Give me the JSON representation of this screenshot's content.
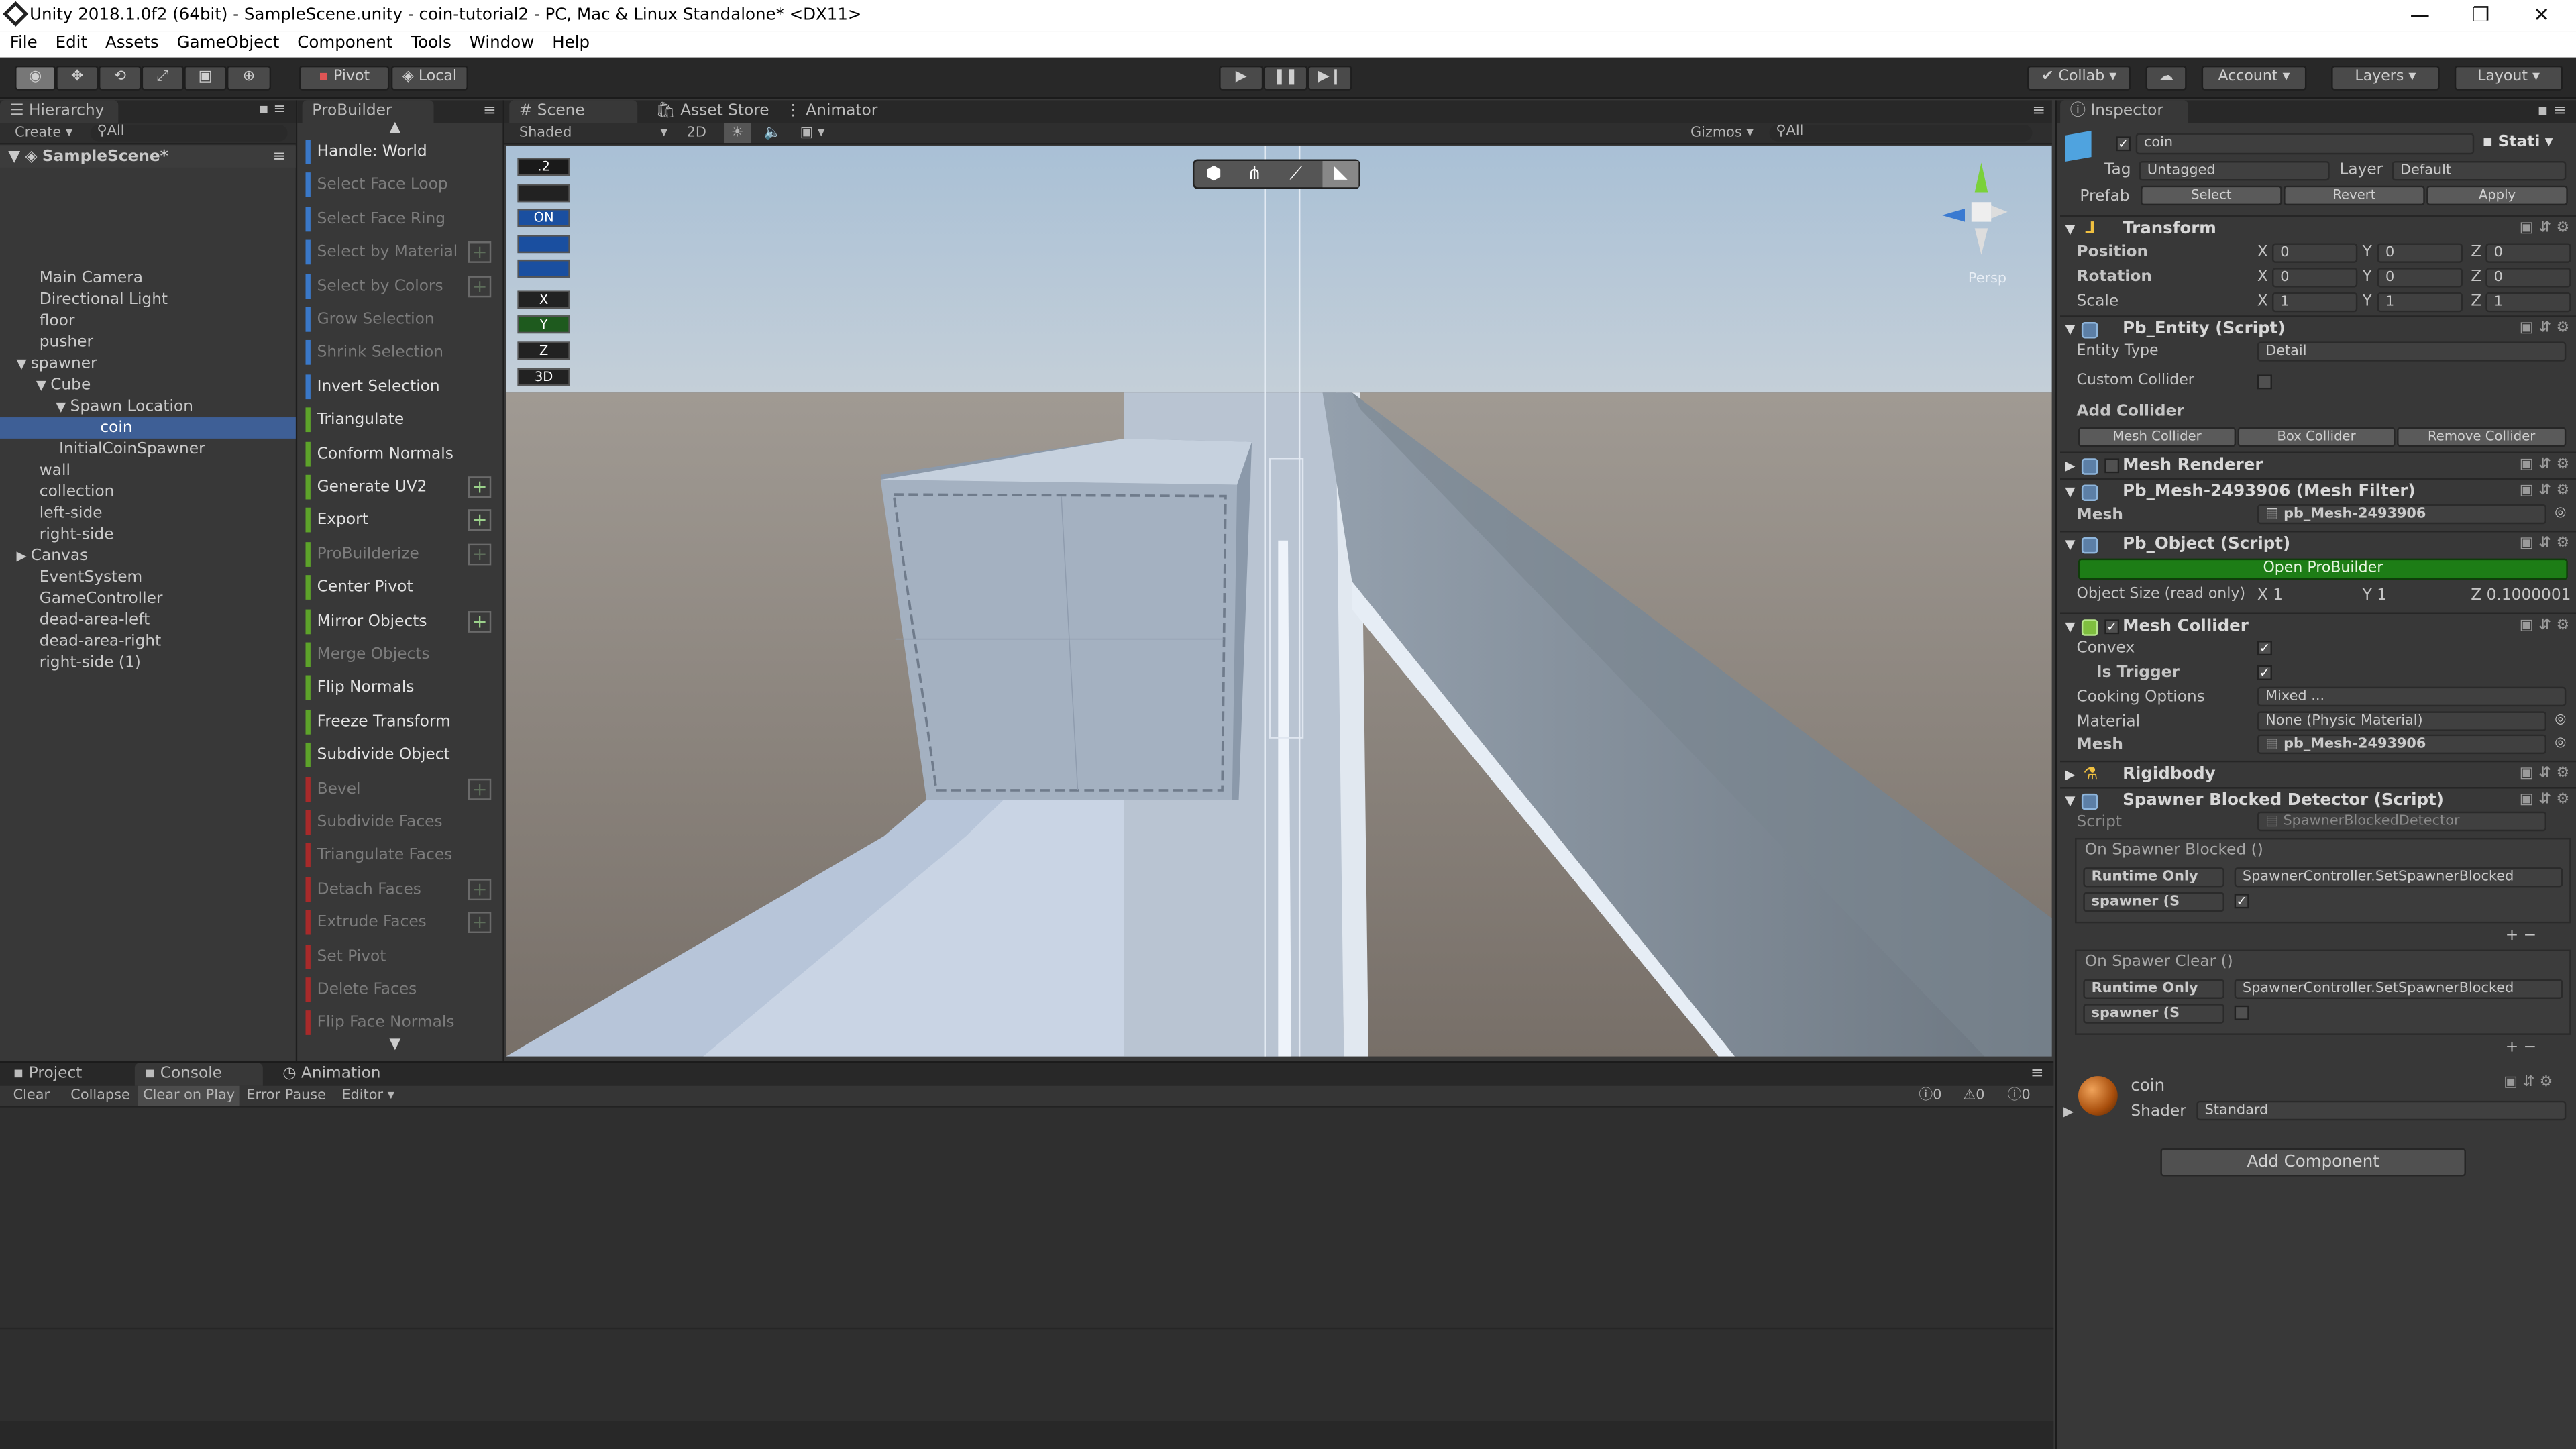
{
  "window": {
    "title": "Unity 2018.1.0f2 (64bit) - SampleScene.unity - coin-tutorial2 - PC, Mac & Linux Standalone* <DX11>",
    "controls": [
      "—",
      "❐",
      "✕"
    ]
  },
  "menu": [
    "File",
    "Edit",
    "Assets",
    "GameObject",
    "Component",
    "Tools",
    "Window",
    "Help"
  ],
  "toolbar": {
    "pivot": "Pivot",
    "local": "Local",
    "collab": "Collab",
    "account": "Account",
    "layers": "Layers",
    "layout": "Layout"
  },
  "hierarchy": {
    "tab": "Hierarchy",
    "create": "Create",
    "search": "All",
    "scene": "SampleScene*",
    "items": [
      {
        "label": "Main Camera",
        "indent": 1
      },
      {
        "label": "Directional Light",
        "indent": 1
      },
      {
        "label": "floor",
        "indent": 1
      },
      {
        "label": "pusher",
        "indent": 1
      },
      {
        "label": "spawner",
        "indent": 1,
        "arrow": "▼"
      },
      {
        "label": "Cube",
        "indent": 2,
        "arrow": "▼"
      },
      {
        "label": "Spawn Location",
        "indent": 3,
        "arrow": "▼"
      },
      {
        "label": "coin",
        "indent": 4,
        "selected": true
      },
      {
        "label": "InitialCoinSpawner",
        "indent": 2
      },
      {
        "label": "wall",
        "indent": 1
      },
      {
        "label": "collection",
        "indent": 1
      },
      {
        "label": "left-side",
        "indent": 1
      },
      {
        "label": "right-side",
        "indent": 1
      },
      {
        "label": "Canvas",
        "indent": 1,
        "arrow": "▶"
      },
      {
        "label": "EventSystem",
        "indent": 1
      },
      {
        "label": "GameController",
        "indent": 1
      },
      {
        "label": "dead-area-left",
        "indent": 1
      },
      {
        "label": "dead-area-right",
        "indent": 1
      },
      {
        "label": "right-side (1)",
        "indent": 1
      }
    ]
  },
  "probuilder": {
    "tab": "ProBuilder",
    "items": [
      {
        "label": "Handle: World",
        "color": "#3a78c8",
        "enabled": true
      },
      {
        "label": "Select Face Loop",
        "color": "#3a78c8",
        "enabled": false
      },
      {
        "label": "Select Face Ring",
        "color": "#3a78c8",
        "enabled": false
      },
      {
        "label": "Select by Material",
        "color": "#3a78c8",
        "enabled": false,
        "plus": true
      },
      {
        "label": "Select by Colors",
        "color": "#3a78c8",
        "enabled": false,
        "plus": true
      },
      {
        "label": "Grow Selection",
        "color": "#3a78c8",
        "enabled": false
      },
      {
        "label": "Shrink Selection",
        "color": "#3a78c8",
        "enabled": false
      },
      {
        "label": "Invert Selection",
        "color": "#3a78c8",
        "enabled": true
      },
      {
        "label": "Triangulate",
        "color": "#5da32a",
        "enabled": true
      },
      {
        "label": "Conform Normals",
        "color": "#5da32a",
        "enabled": true
      },
      {
        "label": "Generate UV2",
        "color": "#5da32a",
        "enabled": true,
        "plus": true
      },
      {
        "label": "Export",
        "color": "#5da32a",
        "enabled": true,
        "plus": true
      },
      {
        "label": "ProBuilderize",
        "color": "#5da32a",
        "enabled": false,
        "plus": true
      },
      {
        "label": "Center Pivot",
        "color": "#5da32a",
        "enabled": true
      },
      {
        "label": "Mirror Objects",
        "color": "#5da32a",
        "enabled": true,
        "plus": true
      },
      {
        "label": "Merge Objects",
        "color": "#5da32a",
        "enabled": false
      },
      {
        "label": "Flip Normals",
        "color": "#5da32a",
        "enabled": true
      },
      {
        "label": "Freeze Transform",
        "color": "#5da32a",
        "enabled": true
      },
      {
        "label": "Subdivide Object",
        "color": "#5da32a",
        "enabled": true
      },
      {
        "label": "Bevel",
        "color": "#a82a2a",
        "enabled": false,
        "plus": true
      },
      {
        "label": "Subdivide Faces",
        "color": "#a82a2a",
        "enabled": false
      },
      {
        "label": "Triangulate Faces",
        "color": "#a82a2a",
        "enabled": false
      },
      {
        "label": "Detach Faces",
        "color": "#a82a2a",
        "enabled": false,
        "plus": true
      },
      {
        "label": "Extrude Faces",
        "color": "#a82a2a",
        "enabled": false,
        "plus": true
      },
      {
        "label": "Set Pivot",
        "color": "#a82a2a",
        "enabled": false
      },
      {
        "label": "Delete Faces",
        "color": "#a82a2a",
        "enabled": false
      },
      {
        "label": "Flip Face Normals",
        "color": "#a82a2a",
        "enabled": false
      }
    ]
  },
  "scene": {
    "tabs": [
      "Scene",
      "Asset Store",
      "Animator"
    ],
    "shading": "Shaded",
    "mode2d": "2D",
    "gizmos": "Gizmos",
    "search": "All",
    "persp": "Persp",
    "tools": [
      ".2",
      "",
      "ON",
      "",
      "",
      "X",
      "Y",
      "Z",
      "3D"
    ]
  },
  "console": {
    "tabs": [
      "Project",
      "Console",
      "Animation"
    ],
    "buttons": [
      "Clear",
      "Collapse",
      "Clear on Play",
      "Error Pause",
      "Editor"
    ],
    "counts": [
      "0",
      "0",
      "0"
    ]
  },
  "inspector": {
    "tab": "Inspector",
    "object_name": "coin",
    "static": "Stati",
    "tag_label": "Tag",
    "tag": "Untagged",
    "layer_label": "Layer",
    "layer": "Default",
    "prefab_label": "Prefab",
    "prefab_buttons": [
      "Select",
      "Revert",
      "Apply"
    ],
    "transform": {
      "title": "Transform",
      "rows": [
        {
          "label": "Position",
          "x": "0",
          "y": "0",
          "z": "0"
        },
        {
          "label": "Rotation",
          "x": "0",
          "y": "0",
          "z": "0"
        },
        {
          "label": "Scale",
          "x": "1",
          "y": "1",
          "z": "1"
        }
      ]
    },
    "pb_entity": {
      "title": "Pb_Entity (Script)",
      "entity_type_label": "Entity Type",
      "entity_type": "Detail",
      "custom_collider": "Custom Collider",
      "add_collider": "Add Collider",
      "buttons": [
        "Mesh Collider",
        "Box Collider",
        "Remove Collider"
      ]
    },
    "mesh_renderer": "Mesh Renderer",
    "mesh_filter": {
      "title": "Pb_Mesh-2493906 (Mesh Filter)",
      "mesh_label": "Mesh",
      "mesh": "pb_Mesh-2493906"
    },
    "pb_object": {
      "title": "Pb_Object (Script)",
      "open_button": "Open ProBuilder",
      "size_label": "Object Size (read only)",
      "x": "1",
      "y": "1",
      "z": "0.1000001"
    },
    "mesh_collider": {
      "title": "Mesh Collider",
      "convex": "Convex",
      "is_trigger": "Is Trigger",
      "cooking_label": "Cooking Options",
      "cooking": "Mixed ...",
      "material_label": "Material",
      "material": "None (Physic Material)",
      "mesh_label": "Mesh",
      "mesh": "pb_Mesh-2493906"
    },
    "rigidbody": "Rigidbody",
    "spawner_detector": {
      "title": "Spawner Blocked Detector (Script)",
      "script_label": "Script",
      "script": "SpawnerBlockedDetector",
      "events": [
        {
          "title": "On Spawner Blocked ()",
          "mode": "Runtime Only",
          "func": "SpawnerController.SetSpawnerBlocked",
          "target": "spawner (S",
          "checked": true
        },
        {
          "title": "On Spawer Clear ()",
          "mode": "Runtime Only",
          "func": "SpawnerController.SetSpawnerBlocked",
          "target": "spawner (S",
          "checked": false
        }
      ]
    },
    "material": {
      "name": "coin",
      "shader_label": "Shader",
      "shader": "Standard"
    },
    "add_component": "Add Component"
  }
}
